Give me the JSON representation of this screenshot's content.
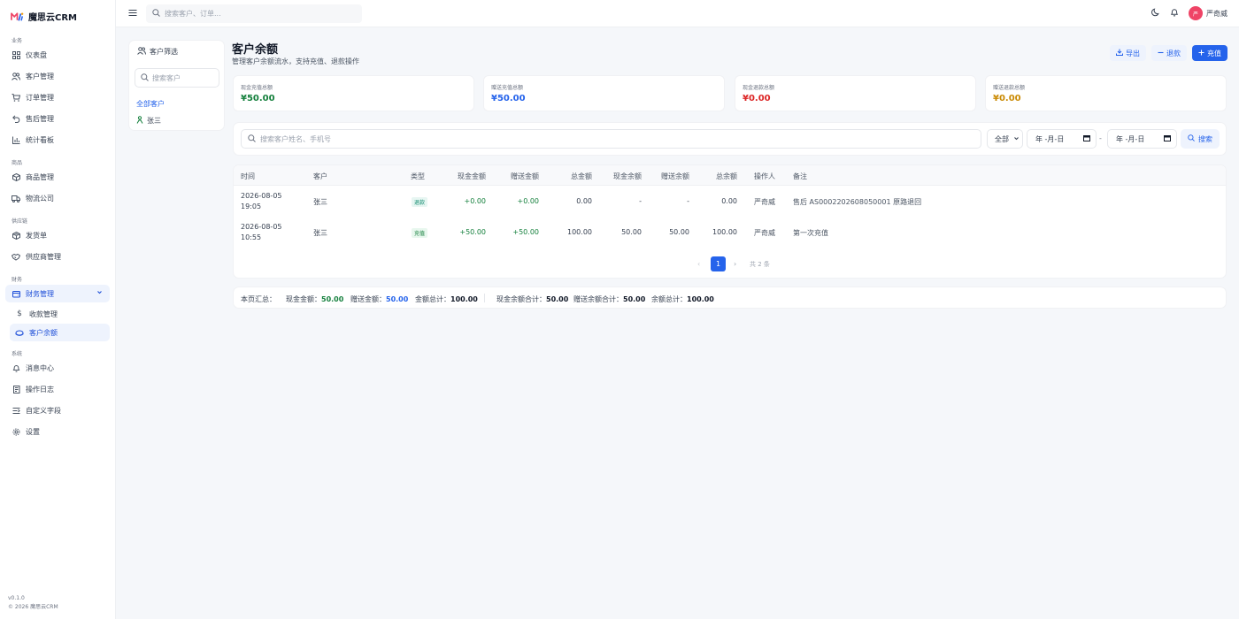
{
  "app": {
    "name": "魔思云CRM",
    "version": "v0.1.0",
    "copyright": "© 2026 魔思云CRM"
  },
  "colors": {
    "primary": "#2563eb",
    "success": "#15803d",
    "danger": "#dc2626",
    "warning": "#ca8a04",
    "avatar": "#ef4466"
  },
  "topbar": {
    "search_placeholder": "搜索客户、订单...",
    "user_name": "严奇威",
    "avatar_text": "严"
  },
  "sidebar": {
    "sections": [
      {
        "title": "业务",
        "items": [
          {
            "label": "仪表盘",
            "icon": "dashboard-icon"
          },
          {
            "label": "客户管理",
            "icon": "users-icon"
          },
          {
            "label": "订单管理",
            "icon": "cart-icon"
          },
          {
            "label": "售后管理",
            "icon": "return-icon"
          },
          {
            "label": "统计看板",
            "icon": "chart-icon"
          }
        ]
      },
      {
        "title": "商品",
        "items": [
          {
            "label": "商品管理",
            "icon": "box-icon"
          },
          {
            "label": "物流公司",
            "icon": "truck-icon"
          }
        ]
      },
      {
        "title": "供应链",
        "items": [
          {
            "label": "发货单",
            "icon": "package-icon"
          },
          {
            "label": "供应商管理",
            "icon": "handshake-icon"
          }
        ]
      },
      {
        "title": "财务",
        "items": [
          {
            "label": "财务管理",
            "icon": "wallet-icon"
          },
          {
            "label": "收款管理",
            "icon": "dollar-icon"
          },
          {
            "label": "客户余额",
            "icon": "coin-icon"
          }
        ]
      },
      {
        "title": "系统",
        "items": [
          {
            "label": "消息中心",
            "icon": "bell-icon"
          },
          {
            "label": "操作日志",
            "icon": "log-icon"
          },
          {
            "label": "自定义字段",
            "icon": "fields-icon"
          },
          {
            "label": "设置",
            "icon": "gear-icon"
          }
        ]
      }
    ]
  },
  "filter_panel": {
    "title": "客户筛选",
    "search_placeholder": "搜索客户",
    "all_label": "全部客户",
    "customers": [
      "张三"
    ]
  },
  "header": {
    "title": "客户余额",
    "subtitle": "管理客户余额流水，支持充值、退款操作",
    "export_label": "导出",
    "refund_label": "退款",
    "recharge_label": "充值"
  },
  "stats": [
    {
      "label": "现金充值总额",
      "value": "¥50.00",
      "color": "#15803d"
    },
    {
      "label": "赠送充值总额",
      "value": "¥50.00",
      "color": "#2563eb"
    },
    {
      "label": "现金退款总额",
      "value": "¥0.00",
      "color": "#dc2626"
    },
    {
      "label": "赠送退款总额",
      "value": "¥0.00",
      "color": "#ca8a04"
    }
  ],
  "filter_bar": {
    "search_placeholder": "搜索客户姓名、手机号",
    "type_selected": "全部",
    "date_placeholder": "年 -月-日",
    "date_separator": "-",
    "search_button": "搜索"
  },
  "table": {
    "headers": [
      "时间",
      "客户",
      "类型",
      "现金金额",
      "赠送金额",
      "总金额",
      "现金余额",
      "赠送余额",
      "总余额",
      "操作人",
      "备注"
    ],
    "rows": [
      {
        "date": "2026-08-05",
        "time": "19:05",
        "customer": "张三",
        "type": "退款",
        "cash": "+0.00",
        "gift": "+0.00",
        "total": "0.00",
        "cash_bal": "-",
        "gift_bal": "-",
        "total_bal": "0.00",
        "operator": "严奇威",
        "note": "售后 AS0002202608050001 原路退回"
      },
      {
        "date": "2026-08-05",
        "time": "10:55",
        "customer": "张三",
        "type": "充值",
        "cash": "+50.00",
        "gift": "+50.00",
        "total": "100.00",
        "cash_bal": "50.00",
        "gift_bal": "50.00",
        "total_bal": "100.00",
        "operator": "严奇威",
        "note": "第一次充值"
      }
    ]
  },
  "pagination": {
    "current": "1",
    "total_text": "共 2 条"
  },
  "summary": {
    "label": "本页汇总：",
    "items": [
      {
        "label": "现金金额：",
        "value": "50.00",
        "color": "#15803d"
      },
      {
        "label": "赠送金额：",
        "value": "50.00",
        "color": "#2563eb"
      },
      {
        "label": "金额总计：",
        "value": "100.00",
        "color": "#111827"
      },
      {
        "label": "现金余额合计：",
        "value": "50.00",
        "color": "#111827"
      },
      {
        "label": "赠送余额合计：",
        "value": "50.00",
        "color": "#111827"
      },
      {
        "label": "余额总计：",
        "value": "100.00",
        "color": "#111827"
      }
    ]
  }
}
